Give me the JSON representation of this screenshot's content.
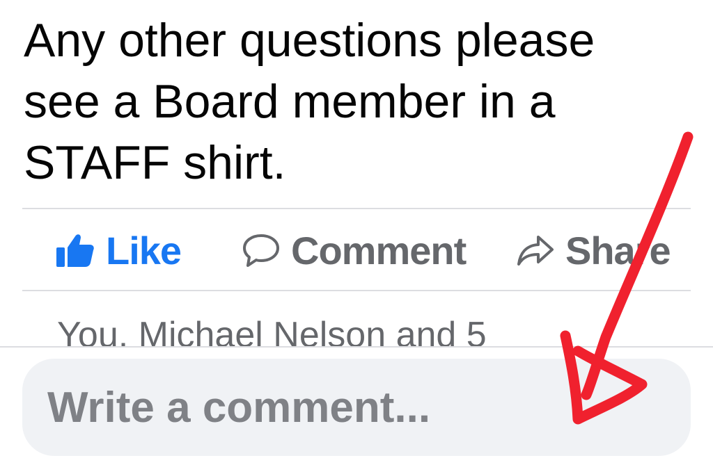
{
  "post": {
    "text_lines": [
      "Any other questions please",
      "see a Board member in a",
      "STAFF shirt."
    ]
  },
  "actions": {
    "like_label": "Like",
    "comment_label": "Comment",
    "share_label": "Share"
  },
  "reactions": {
    "summary": "You, Michael Nelson and 5"
  },
  "composer": {
    "placeholder": "Write a comment..."
  },
  "icons": {
    "like": "thumbs-up-icon",
    "comment": "speech-bubble-icon",
    "share": "share-arrow-icon"
  },
  "colors": {
    "like_blue": "#1877f2",
    "action_gray": "#65676b",
    "annotation_red": "#f0212e",
    "input_bg": "#f0f2f5"
  }
}
